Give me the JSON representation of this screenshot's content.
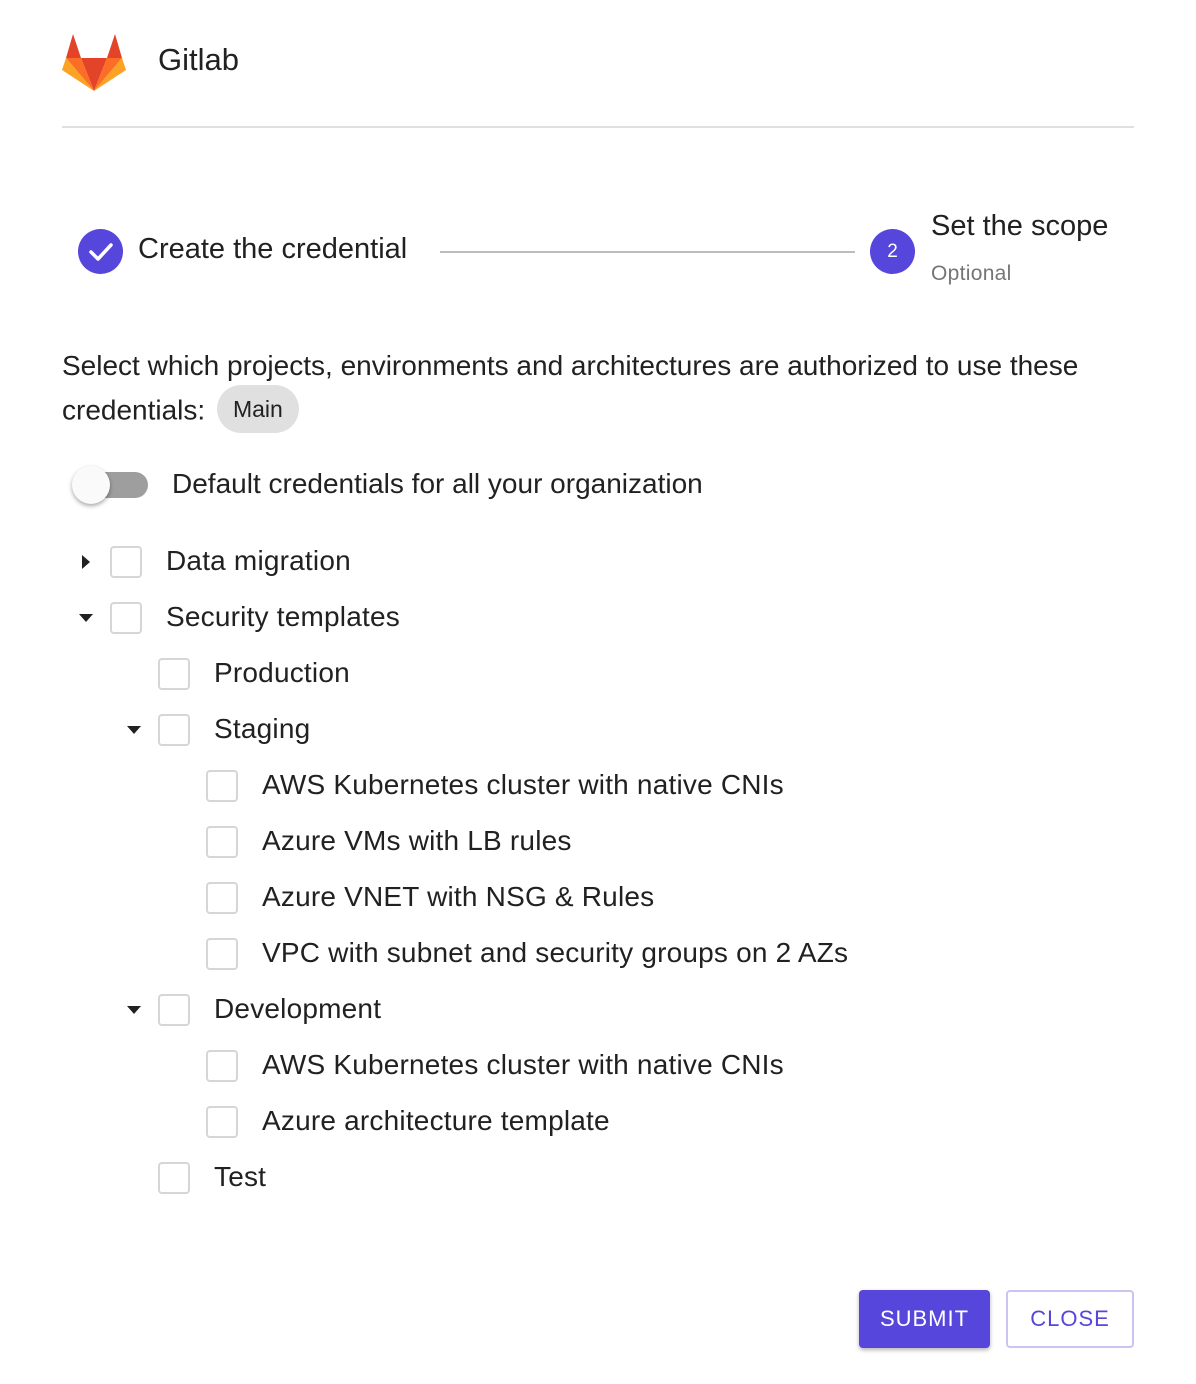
{
  "header": {
    "app_name": "Gitlab",
    "logo_icon": "gitlab-logo-icon"
  },
  "stepper": {
    "step1": {
      "label": "Create the credential",
      "state": "completed",
      "icon": "check-icon"
    },
    "step2": {
      "number": "2",
      "label": "Set the scope",
      "sublabel": "Optional",
      "state": "active"
    }
  },
  "description": {
    "text": "Select which projects, environments and architectures are authorized to use these credentials:",
    "chip": "Main"
  },
  "toggle": {
    "label": "Default credentials for all your organization",
    "checked": false
  },
  "tree": [
    {
      "label": "Data migration",
      "expander": "collapsed",
      "checked": false
    },
    {
      "label": "Security templates",
      "expander": "expanded",
      "checked": false
    },
    {
      "label": "Production",
      "expander": "none",
      "checked": false
    },
    {
      "label": "Staging",
      "expander": "expanded",
      "checked": false
    },
    {
      "label": "AWS Kubernetes cluster with native CNIs",
      "expander": "none",
      "checked": false
    },
    {
      "label": "Azure VMs with LB rules",
      "expander": "none",
      "checked": false
    },
    {
      "label": "Azure VNET with NSG & Rules",
      "expander": "none",
      "checked": false
    },
    {
      "label": "VPC with subnet and security groups on 2 AZs",
      "expander": "none",
      "checked": false
    },
    {
      "label": "Development",
      "expander": "expanded",
      "checked": false
    },
    {
      "label": "AWS Kubernetes cluster with native CNIs",
      "expander": "none",
      "checked": false
    },
    {
      "label": "Azure architecture template",
      "expander": "none",
      "checked": false
    },
    {
      "label": "Test",
      "expander": "none",
      "checked": false
    }
  ],
  "actions": {
    "submit_label": "SUBMIT",
    "close_label": "CLOSE"
  },
  "colors": {
    "primary": "#5646db",
    "text": "#212121",
    "muted": "#757575"
  }
}
